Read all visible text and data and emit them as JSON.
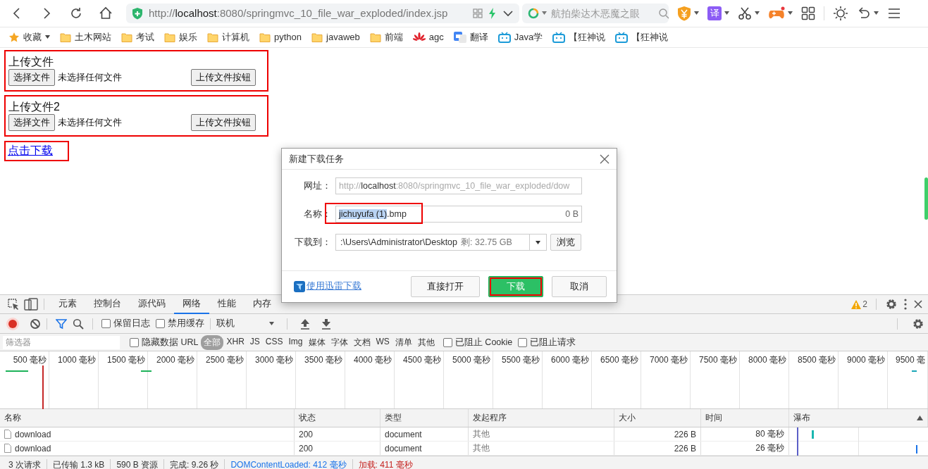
{
  "browser": {
    "address": {
      "scheme": "http://",
      "host": "localhost",
      "rest": ":8080/springmvc_10_file_war_exploded/index.jsp"
    },
    "search": {
      "placeholder": "航拍柴达木恶魔之眼"
    },
    "translate_badge": "译"
  },
  "bookmarks": [
    {
      "label": "收藏",
      "kind": "star"
    },
    {
      "label": "土木网站",
      "kind": "folder"
    },
    {
      "label": "考试",
      "kind": "folder"
    },
    {
      "label": "娱乐",
      "kind": "folder"
    },
    {
      "label": "计算机",
      "kind": "folder"
    },
    {
      "label": "python",
      "kind": "folder"
    },
    {
      "label": "javaweb",
      "kind": "folder"
    },
    {
      "label": "前端",
      "kind": "folder"
    },
    {
      "label": "agc",
      "kind": "huawei"
    },
    {
      "label": "翻译",
      "kind": "translate"
    },
    {
      "label": "Java学",
      "kind": "tv"
    },
    {
      "label": "【狂神说",
      "kind": "tv"
    },
    {
      "label": "【狂神说",
      "kind": "tv"
    }
  ],
  "page": {
    "upload_forms": [
      {
        "title": "上传文件",
        "choose_button": "选择文件",
        "file_status": "未选择任何文件",
        "submit_button": "上传文件按钮"
      },
      {
        "title": "上传文件2",
        "choose_button": "选择文件",
        "file_status": "未选择任何文件",
        "submit_button": "上传文件按钮"
      }
    ],
    "download_link": "点击下载"
  },
  "dialog": {
    "title": "新建下载任务",
    "fields": [
      {
        "kind": "url",
        "label": "网址：",
        "scheme": "http://",
        "host": "localhost",
        "rest": ":8080/springmvc_10_file_war_exploded/dow",
        "annotated": false
      },
      {
        "kind": "name",
        "label": "名称：",
        "selected_text": "jichuyufa (1)",
        "rest": ".bmp",
        "size": "0 B",
        "annotated": true
      },
      {
        "kind": "path",
        "label": "下载到：",
        "value": ":\\Users\\Administrator\\Desktop",
        "free": "剩: 32.75 GB",
        "button": "浏览",
        "annotated": false
      }
    ],
    "thunder_link": "使用迅雷下载",
    "buttons": [
      {
        "label": "直接打开",
        "primary": false,
        "annotated": false
      },
      {
        "label": "下载",
        "primary": true,
        "annotated": true
      },
      {
        "label": "取消",
        "primary": false,
        "annotated": false
      }
    ]
  },
  "devtools": {
    "tabs": [
      {
        "label": "元素",
        "selected": false
      },
      {
        "label": "控制台",
        "selected": false
      },
      {
        "label": "源代码",
        "selected": false
      },
      {
        "label": "网络",
        "selected": true
      },
      {
        "label": "性能",
        "selected": false
      },
      {
        "label": "内存",
        "selected": false
      }
    ],
    "warning_count": "2",
    "toolbar": {
      "recording": true,
      "checkboxes": [
        {
          "label": "保留日志",
          "checked": false
        },
        {
          "label": "禁用缓存",
          "checked": false
        }
      ],
      "throttling": "联机"
    },
    "filter": {
      "placeholder": "筛选器",
      "hide_data_urls": {
        "label": "隐藏数据 URL",
        "checked": false
      },
      "types": [
        {
          "label": "全部",
          "selected": true
        },
        {
          "label": "XHR",
          "selected": false
        },
        {
          "label": "JS",
          "selected": false
        },
        {
          "label": "CSS",
          "selected": false
        },
        {
          "label": "Img",
          "selected": false
        },
        {
          "label": "媒体",
          "selected": false
        },
        {
          "label": "字体",
          "selected": false
        },
        {
          "label": "文档",
          "selected": false
        },
        {
          "label": "WS",
          "selected": false
        },
        {
          "label": "清单",
          "selected": false
        },
        {
          "label": "其他",
          "selected": false
        }
      ],
      "blocked": [
        {
          "label": "已阻止 Cookie",
          "checked": false
        },
        {
          "label": "已阻止请求",
          "checked": false
        }
      ]
    },
    "timeline": {
      "ticks": [
        "500 毫秒",
        "1000 毫秒",
        "1500 毫秒",
        "2000 毫秒",
        "2500 毫秒",
        "3000 毫秒",
        "3500 毫秒",
        "4000 毫秒",
        "4500 毫秒",
        "5000 毫秒",
        "5500 毫秒",
        "6000 毫秒",
        "6500 毫秒",
        "7000 毫秒",
        "7500 毫秒",
        "8000 毫秒",
        "8500 毫秒",
        "9000 毫秒",
        "9500 毫"
      ]
    },
    "table": {
      "columns": [
        "名称",
        "状态",
        "类型",
        "发起程序",
        "大小",
        "时间",
        "瀑布"
      ],
      "rows": [
        [
          "download",
          "200",
          "document",
          "其他",
          "226 B",
          "80 毫秒"
        ],
        [
          "download",
          "200",
          "document",
          "其他",
          "226 B",
          "26 毫秒"
        ]
      ]
    },
    "status_bar": [
      {
        "text": "3 次请求",
        "kind": "plain"
      },
      {
        "text": "已传输 1.3 kB",
        "kind": "plain"
      },
      {
        "text": "590 B 资源",
        "kind": "plain"
      },
      {
        "text": "完成: 9.26 秒",
        "kind": "plain"
      },
      {
        "text": "DOMContentLoaded: 412 毫秒",
        "kind": "dom"
      },
      {
        "text": "加载: 411 毫秒",
        "kind": "load"
      }
    ]
  }
}
